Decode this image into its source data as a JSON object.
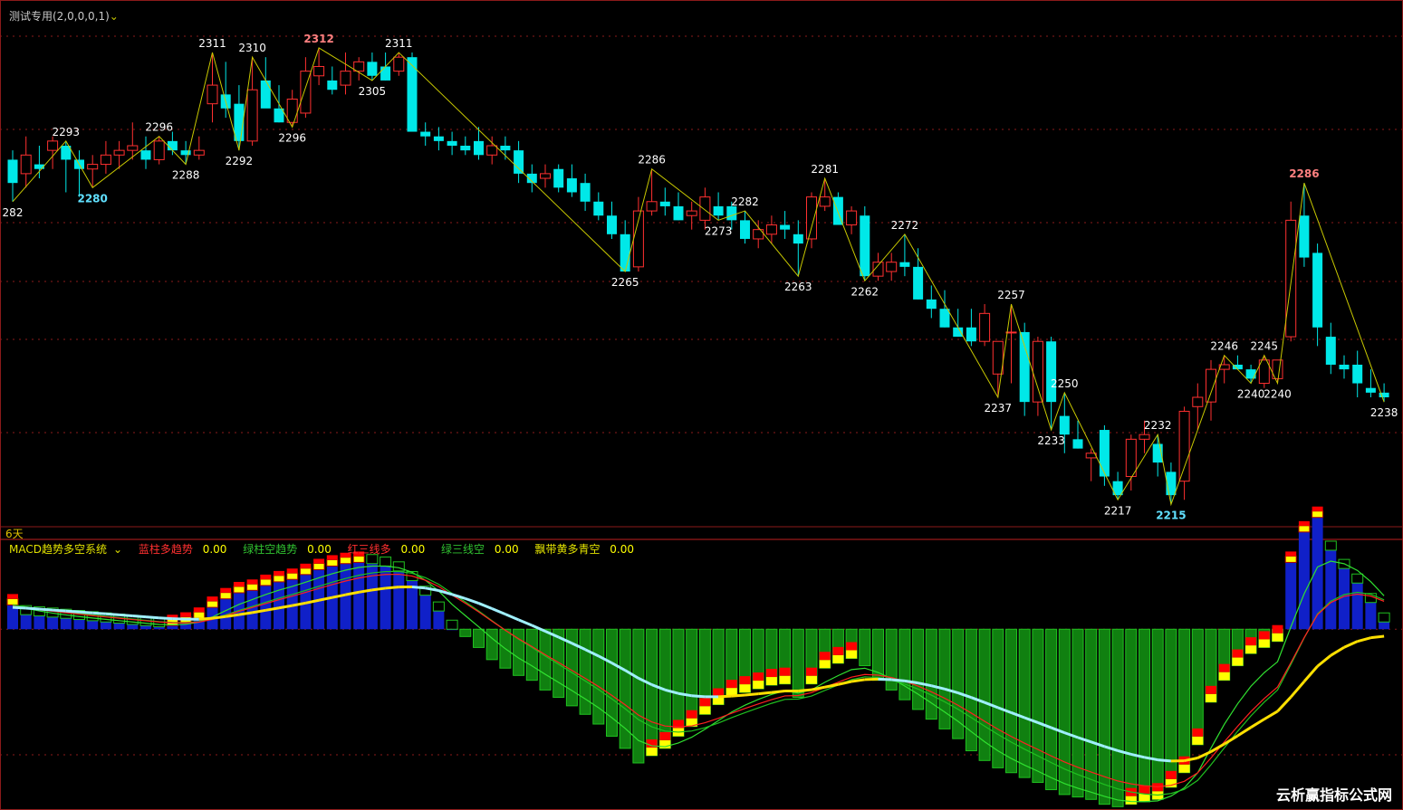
{
  "upper_header": {
    "title": "测试专用(2,0,0,0,1)",
    "caret": "⌄"
  },
  "days_label": "6天",
  "macd_header": {
    "title": "MACD趋势多空系统",
    "caret": "⌄",
    "items": [
      {
        "label": "蓝柱多趋势",
        "value": "0.00",
        "color": "#ff3030"
      },
      {
        "label": "绿柱空趋势",
        "value": "0.00",
        "color": "#30c030"
      },
      {
        "label": "红三线多",
        "value": "0.00",
        "color": "#ff3030"
      },
      {
        "label": "绿三线空",
        "value": "0.00",
        "color": "#30c030"
      },
      {
        "label": "飘带黄多青空",
        "value": "0.00",
        "color": "#e0e000"
      }
    ]
  },
  "watermark": "云析赢指标公式网",
  "colors": {
    "up": "#ff3030",
    "down": "#00e8e8",
    "zigzag": "#c8c800",
    "grid": "#8b1a1a",
    "pivot_high": "#ff8080",
    "pivot_low": "#60e0ff"
  },
  "chart_data": [
    {
      "type": "candlestick",
      "title": "",
      "price_range": [
        2210,
        2318
      ],
      "candles": [
        [
          2288,
          2290,
          2279,
          2283
        ],
        [
          2285,
          2293,
          2282,
          2289
        ],
        [
          2287,
          2291,
          2284,
          2286
        ],
        [
          2290,
          2293,
          2286,
          2292
        ],
        [
          2291,
          2292,
          2281,
          2288
        ],
        [
          2288,
          2290,
          2280,
          2286
        ],
        [
          2286,
          2289,
          2282,
          2287
        ],
        [
          2287,
          2292,
          2285,
          2289
        ],
        [
          2289,
          2292,
          2286,
          2290
        ],
        [
          2290,
          2296,
          2288,
          2291
        ],
        [
          2290,
          2293,
          2286,
          2288
        ],
        [
          2288,
          2293,
          2287,
          2292
        ],
        [
          2292,
          2294,
          2289,
          2290
        ],
        [
          2290,
          2292,
          2287,
          2289
        ],
        [
          2289,
          2293,
          2288,
          2290
        ],
        [
          2300,
          2311,
          2296,
          2304
        ],
        [
          2302,
          2309,
          2297,
          2299
        ],
        [
          2300,
          2304,
          2290,
          2292
        ],
        [
          2292,
          2310,
          2291,
          2303
        ],
        [
          2305,
          2310,
          2300,
          2299
        ],
        [
          2299,
          2304,
          2296,
          2296
        ],
        [
          2296,
          2303,
          2295,
          2301
        ],
        [
          2298,
          2310,
          2297,
          2307
        ],
        [
          2306,
          2312,
          2304,
          2308
        ],
        [
          2305,
          2308,
          2302,
          2303
        ],
        [
          2304,
          2311,
          2302,
          2307
        ],
        [
          2307,
          2310,
          2305,
          2309
        ],
        [
          2309,
          2311,
          2305,
          2306
        ],
        [
          2308,
          2311,
          2305,
          2305
        ],
        [
          2307,
          2311,
          2306,
          2310
        ],
        [
          2310,
          2311,
          2294,
          2294
        ],
        [
          2294,
          2296,
          2291,
          2293
        ],
        [
          2293,
          2295,
          2290,
          2292
        ],
        [
          2292,
          2294,
          2289,
          2291
        ],
        [
          2291,
          2293,
          2289,
          2290
        ],
        [
          2292,
          2295,
          2288,
          2289
        ],
        [
          2289,
          2293,
          2287,
          2291
        ],
        [
          2291,
          2293,
          2288,
          2290
        ],
        [
          2290,
          2292,
          2283,
          2285
        ],
        [
          2285,
          2287,
          2281,
          2283
        ],
        [
          2284,
          2287,
          2282,
          2285
        ],
        [
          2286,
          2287,
          2281,
          2282
        ],
        [
          2284,
          2287,
          2280,
          2281
        ],
        [
          2283,
          2285,
          2277,
          2279
        ],
        [
          2279,
          2281,
          2275,
          2276
        ],
        [
          2276,
          2279,
          2271,
          2272
        ],
        [
          2272,
          2275,
          2264,
          2264
        ],
        [
          2265,
          2280,
          2264,
          2277
        ],
        [
          2277,
          2286,
          2276,
          2279
        ],
        [
          2279,
          2282,
          2276,
          2278
        ],
        [
          2278,
          2281,
          2275,
          2275
        ],
        [
          2276,
          2279,
          2273,
          2277
        ],
        [
          2275,
          2282,
          2273,
          2280
        ],
        [
          2278,
          2281,
          2275,
          2276
        ],
        [
          2278,
          2279,
          2273,
          2275
        ],
        [
          2275,
          2277,
          2270,
          2271
        ],
        [
          2271,
          2275,
          2269,
          2273
        ],
        [
          2272,
          2276,
          2270,
          2274
        ],
        [
          2274,
          2277,
          2271,
          2273
        ],
        [
          2272,
          2275,
          2263,
          2270
        ],
        [
          2271,
          2281,
          2269,
          2280
        ],
        [
          2278,
          2284,
          2277,
          2280
        ],
        [
          2280,
          2281,
          2274,
          2274
        ],
        [
          2274,
          2278,
          2272,
          2277
        ],
        [
          2276,
          2278,
          2262,
          2263
        ],
        [
          2263,
          2268,
          2262,
          2266
        ],
        [
          2264,
          2268,
          2262,
          2266
        ],
        [
          2266,
          2272,
          2263,
          2265
        ],
        [
          2265,
          2269,
          2258,
          2258
        ],
        [
          2258,
          2261,
          2254,
          2256
        ],
        [
          2256,
          2260,
          2252,
          2252
        ],
        [
          2252,
          2256,
          2250,
          2250
        ],
        [
          2252,
          2256,
          2248,
          2249
        ],
        [
          2249,
          2257,
          2248,
          2255
        ],
        [
          2242,
          2247,
          2237,
          2249
        ],
        [
          2251,
          2257,
          2240,
          2251
        ],
        [
          2251,
          2253,
          2233,
          2236
        ],
        [
          2236,
          2250,
          2233,
          2249
        ],
        [
          2249,
          2250,
          2230,
          2236
        ],
        [
          2233,
          2238,
          2225,
          2229
        ],
        [
          2228,
          2232,
          2226,
          2226
        ],
        [
          2224,
          2226,
          2219,
          2225
        ],
        [
          2230,
          2231,
          2218,
          2220
        ],
        [
          2219,
          2221,
          2215,
          2216
        ],
        [
          2220,
          2229,
          2217,
          2228
        ],
        [
          2228,
          2232,
          2225,
          2229
        ],
        [
          2227,
          2229,
          2220,
          2223
        ],
        [
          2221,
          2223,
          2214,
          2216
        ],
        [
          2219,
          2235,
          2215,
          2234
        ],
        [
          2235,
          2240,
          2230,
          2237
        ],
        [
          2236,
          2245,
          2232,
          2243
        ],
        [
          2243,
          2246,
          2240,
          2244
        ],
        [
          2244,
          2246,
          2243,
          2243
        ],
        [
          2243,
          2244,
          2240,
          2241
        ],
        [
          2240,
          2246,
          2239,
          2245
        ],
        [
          2241,
          2245,
          2240,
          2245
        ],
        [
          2250,
          2279,
          2249,
          2275
        ],
        [
          2276,
          2283,
          2265,
          2267
        ],
        [
          2268,
          2270,
          2248,
          2252
        ],
        [
          2250,
          2253,
          2242,
          2244
        ],
        [
          2244,
          2246,
          2241,
          2243
        ],
        [
          2244,
          2247,
          2237,
          2240
        ],
        [
          2239,
          2243,
          2237,
          2238
        ],
        [
          2238,
          2240,
          2236,
          2237
        ]
      ],
      "pivots": [
        {
          "i": 0,
          "label": "282",
          "kind": "low"
        },
        {
          "i": 4,
          "label": "2293",
          "kind": "high"
        },
        {
          "i": 6,
          "label": "2280",
          "kind": "low",
          "highlight": true
        },
        {
          "i": 11,
          "label": "2296",
          "kind": "high"
        },
        {
          "i": 13,
          "label": "2288",
          "kind": "low"
        },
        {
          "i": 15,
          "label": "2311",
          "kind": "high"
        },
        {
          "i": 17,
          "label": "2292",
          "kind": "low"
        },
        {
          "i": 18,
          "label": "2310",
          "kind": "high"
        },
        {
          "i": 21,
          "label": "2296",
          "kind": "low"
        },
        {
          "i": 23,
          "label": "2312",
          "kind": "high",
          "highlight": true
        },
        {
          "i": 27,
          "label": "2305",
          "kind": "low"
        },
        {
          "i": 29,
          "label": "2311",
          "kind": "high"
        },
        {
          "i": 46,
          "label": "2265",
          "kind": "low"
        },
        {
          "i": 48,
          "label": "2286",
          "kind": "high"
        },
        {
          "i": 53,
          "label": "2273",
          "kind": "low"
        },
        {
          "i": 55,
          "label": "2282",
          "kind": "high"
        },
        {
          "i": 59,
          "label": "2263",
          "kind": "low"
        },
        {
          "i": 61,
          "label": "2281",
          "kind": "high"
        },
        {
          "i": 64,
          "label": "2262",
          "kind": "low"
        },
        {
          "i": 67,
          "label": "2272",
          "kind": "high"
        },
        {
          "i": 74,
          "label": "2237",
          "kind": "low"
        },
        {
          "i": 75,
          "label": "2257",
          "kind": "high"
        },
        {
          "i": 78,
          "label": "2233",
          "kind": "low"
        },
        {
          "i": 79,
          "label": "2250",
          "kind": "high"
        },
        {
          "i": 83,
          "label": "2217",
          "kind": "low"
        },
        {
          "i": 86,
          "label": "2232",
          "kind": "high"
        },
        {
          "i": 87,
          "label": "2215",
          "kind": "low",
          "highlight": true
        },
        {
          "i": 91,
          "label": "2246",
          "kind": "high"
        },
        {
          "i": 93,
          "label": "2240",
          "kind": "low"
        },
        {
          "i": 94,
          "label": "2245",
          "kind": "high"
        },
        {
          "i": 95,
          "label": "2240",
          "kind": "low"
        },
        {
          "i": 97,
          "label": "2286",
          "kind": "high",
          "highlight": true
        },
        {
          "i": 103,
          "label": "2238",
          "kind": "low"
        }
      ]
    },
    {
      "type": "bar",
      "title": "MACD趋势多空系统",
      "range": [
        -1.45,
        0.62
      ],
      "histogram": [
        0.2,
        0.12,
        0.11,
        0.1,
        0.09,
        0.08,
        0.07,
        0.06,
        0.05,
        0.04,
        0.03,
        0.02,
        0.03,
        0.05,
        0.09,
        0.18,
        0.25,
        0.3,
        0.32,
        0.36,
        0.39,
        0.41,
        0.45,
        0.49,
        0.52,
        0.54,
        0.55,
        0.54,
        0.52,
        0.48,
        0.4,
        0.28,
        0.15,
        0.0,
        -0.06,
        -0.15,
        -0.25,
        -0.32,
        -0.38,
        -0.42,
        -0.5,
        -0.56,
        -0.63,
        -0.7,
        -0.78,
        -0.88,
        -0.98,
        -1.1,
        -1.04,
        -0.98,
        -0.88,
        -0.8,
        -0.7,
        -0.62,
        -0.55,
        -0.52,
        -0.49,
        -0.46,
        -0.45,
        -0.56,
        -0.45,
        -0.32,
        -0.28,
        -0.24,
        -0.3,
        -0.42,
        -0.5,
        -0.58,
        -0.66,
        -0.74,
        -0.82,
        -0.9,
        -1.0,
        -1.08,
        -1.14,
        -1.18,
        -1.22,
        -1.26,
        -1.32,
        -1.36,
        -1.38,
        -1.4,
        -1.44,
        -1.46,
        -1.44,
        -1.42,
        -1.4,
        -1.3,
        -1.18,
        -0.95,
        -0.6,
        -0.42,
        -0.3,
        -0.2,
        -0.15,
        -0.1,
        0.55,
        0.8,
        0.92,
        0.65,
        0.5,
        0.38,
        0.22,
        0.06
      ]
    }
  ]
}
